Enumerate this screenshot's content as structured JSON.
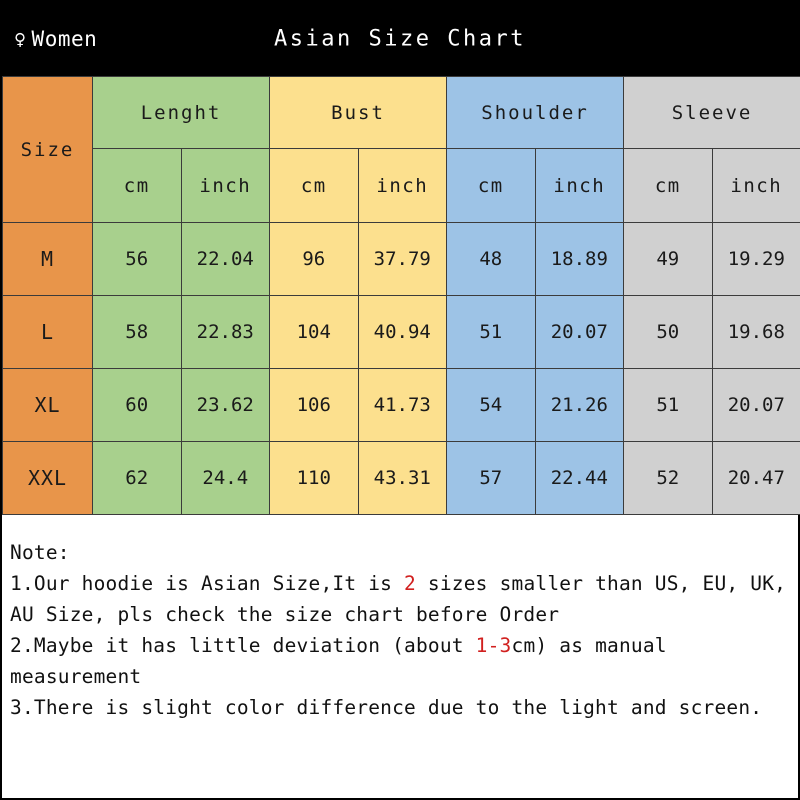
{
  "banner": {
    "gender_icon": "venus-female-icon",
    "gender_label": "Women",
    "title": "Asian Size Chart"
  },
  "table": {
    "size_header": "Size",
    "groups": [
      {
        "label": "Lenght",
        "color": "#a8d08d"
      },
      {
        "label": "Bust",
        "color": "#fce08e"
      },
      {
        "label": "Shoulder",
        "color": "#9dc3e6"
      },
      {
        "label": "Sleeve",
        "color": "#d0d0d0"
      }
    ],
    "units": [
      "cm",
      "inch",
      "cm",
      "inch",
      "cm",
      "inch",
      "cm",
      "inch"
    ],
    "rows": [
      {
        "size": "M",
        "values": [
          "56",
          "22.04",
          "96",
          "37.79",
          "48",
          "18.89",
          "49",
          "19.29"
        ]
      },
      {
        "size": "L",
        "values": [
          "58",
          "22.83",
          "104",
          "40.94",
          "51",
          "20.07",
          "50",
          "19.68"
        ]
      },
      {
        "size": "XL",
        "values": [
          "60",
          "23.62",
          "106",
          "41.73",
          "54",
          "21.26",
          "51",
          "20.07"
        ]
      },
      {
        "size": "XXL",
        "values": [
          "62",
          "24.4",
          "110",
          "43.31",
          "57",
          "22.44",
          "52",
          "20.47"
        ]
      }
    ]
  },
  "notes": {
    "heading": "Note:",
    "line1_a": "1.Our hoodie is Asian Size,It is ",
    "line1_hl": "2",
    "line1_b": " sizes smaller than US, EU, UK, AU Size, pls check the size chart before Order",
    "line2_a": "2.Maybe it has little deviation (about ",
    "line2_hl": "1-3",
    "line2_b": "cm) as manual measurement",
    "line3": "3.There is slight color difference due to the light and screen."
  },
  "colors": {
    "size_col": "#e8954a",
    "length_col": "#a8d08d",
    "bust_col": "#fce08e",
    "shoulder_col": "#9dc3e6",
    "sleeve_col": "#d0d0d0",
    "banner_bg": "#000000",
    "header_text": "#c1561a",
    "highlight": "#d1201f"
  }
}
